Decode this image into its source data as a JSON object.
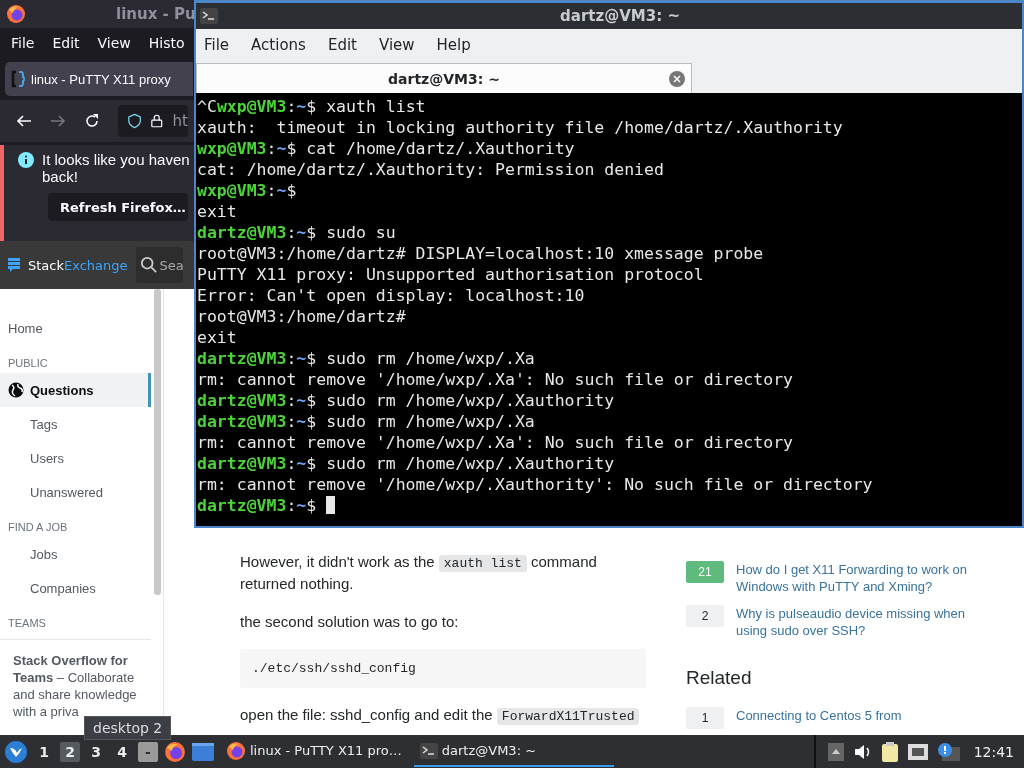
{
  "browser": {
    "title": "linux - Pu",
    "menu": [
      "File",
      "Edit",
      "View",
      "Histo"
    ],
    "tabs": [
      {
        "label": "linux - PuTTY X11 proxy",
        "selected": true
      }
    ],
    "address": "ht",
    "notification": {
      "lines": [
        "It looks like you haven",
        "back!"
      ],
      "button": "Refresh Firefox…"
    },
    "site_header": {
      "logo": [
        "Stack",
        "Exchange"
      ],
      "search_placeholder": "Sea"
    },
    "sidebar": [
      {
        "kind": "top",
        "label": "Home",
        "selected": false
      },
      {
        "kind": "heading",
        "label": "PUBLIC"
      },
      {
        "kind": "primary",
        "label": "Questions",
        "selected": true
      },
      {
        "kind": "sub",
        "label": "Tags",
        "selected": false
      },
      {
        "kind": "sub",
        "label": "Users",
        "selected": false
      },
      {
        "kind": "sub",
        "label": "Unanswered",
        "selected": false
      },
      {
        "kind": "heading",
        "label": "FIND A JOB"
      },
      {
        "kind": "sub",
        "label": "Jobs",
        "selected": false
      },
      {
        "kind": "sub",
        "label": "Companies",
        "selected": false
      },
      {
        "kind": "heading",
        "label": "TEAMS"
      }
    ],
    "teams_promo": "**Stack Overflow for Teams** – Collaborate and share knowledge with a priva",
    "post": [
      {
        "kind": "paragraph",
        "parts": [
          {
            "text": "However, it didn't work as the ",
            "code": false
          },
          {
            "text": "xauth list",
            "code": true
          },
          {
            "text": " command returned nothing.",
            "code": false
          }
        ]
      },
      {
        "kind": "paragraph",
        "parts": [
          {
            "text": "the second solution was to go to:",
            "code": false
          }
        ]
      },
      {
        "kind": "codeblock",
        "text": "./etc/ssh/sshd_config"
      },
      {
        "kind": "paragraph",
        "parts": [
          {
            "text": "open the file: sshd_config and edit the ",
            "code": false
          },
          {
            "text": "ForwardX11Trusted",
            "code": true
          }
        ]
      }
    ],
    "linked": [
      {
        "count": "21",
        "answered": true,
        "title": "How do I get X11 Forwarding to work on Windows with PuTTY and Xming?"
      },
      {
        "count": "2",
        "answered": false,
        "title": "Why is pulseaudio device missing when using sudo over SSH?"
      }
    ],
    "related_heading": "Related",
    "related": [
      {
        "count": "1",
        "answered": false,
        "title": "Connecting to Centos 5 from"
      }
    ]
  },
  "terminal": {
    "title": "dartz@VM3: ~",
    "menu": [
      "File",
      "Actions",
      "Edit",
      "View",
      "Help"
    ],
    "tabs": [
      {
        "label": "dartz@VM3: ~",
        "selected": true
      }
    ],
    "lines": [
      {
        "kind": "prompt",
        "pre": "^C",
        "user": "wxp@VM3",
        "sep": ":",
        "cwd": "~",
        "cmd": "$ xauth list",
        "cursor": false
      },
      {
        "kind": "output",
        "text": "xauth:  timeout in locking authority file /home/dartz/.Xauthority"
      },
      {
        "kind": "prompt",
        "user": "wxp@VM3",
        "sep": ":",
        "cwd": "~",
        "cmd": "$ cat /home/dartz/.Xauthority",
        "cursor": false
      },
      {
        "kind": "output",
        "text": "cat: /home/dartz/.Xauthority: Permission denied"
      },
      {
        "kind": "prompt",
        "user": "wxp@VM3",
        "sep": ":",
        "cwd": "~",
        "cmd": "$",
        "cursor": false
      },
      {
        "kind": "output",
        "text": "exit"
      },
      {
        "kind": "prompt",
        "user": "dartz@VM3",
        "sep": ":",
        "cwd": "~",
        "cmd": "$ sudo su",
        "cursor": false
      },
      {
        "kind": "output",
        "text": "root@VM3:/home/dartz# DISPLAY=localhost:10 xmessage probe"
      },
      {
        "kind": "output",
        "text": "PuTTY X11 proxy: Unsupported authorisation protocol"
      },
      {
        "kind": "output",
        "text": "Error: Can't open display: localhost:10"
      },
      {
        "kind": "output",
        "text": "root@VM3:/home/dartz#"
      },
      {
        "kind": "output",
        "text": "exit"
      },
      {
        "kind": "prompt",
        "user": "dartz@VM3",
        "sep": ":",
        "cwd": "~",
        "cmd": "$ sudo rm /home/wxp/.Xa",
        "cursor": false
      },
      {
        "kind": "output",
        "text": "rm: cannot remove '/home/wxp/.Xa': No such file or directory"
      },
      {
        "kind": "prompt",
        "user": "dartz@VM3",
        "sep": ":",
        "cwd": "~",
        "cmd": "$ sudo rm /home/wxp/.Xauthority",
        "cursor": false
      },
      {
        "kind": "prompt",
        "user": "dartz@VM3",
        "sep": ":",
        "cwd": "~",
        "cmd": "$ sudo rm /home/wxp/.Xa",
        "cursor": false
      },
      {
        "kind": "output",
        "text": "rm: cannot remove '/home/wxp/.Xa': No such file or directory"
      },
      {
        "kind": "prompt",
        "user": "dartz@VM3",
        "sep": ":",
        "cwd": "~",
        "cmd": "$ sudo rm /home/wxp/.Xauthority",
        "cursor": false
      },
      {
        "kind": "output",
        "text": "rm: cannot remove '/home/wxp/.Xauthority': No such file or directory"
      },
      {
        "kind": "prompt",
        "user": "dartz@VM3",
        "sep": ":",
        "cwd": "~",
        "cmd": "$ ",
        "cursor": true
      }
    ]
  },
  "taskbar": {
    "workspaces": [
      {
        "label": "1",
        "selected": false
      },
      {
        "label": "2",
        "selected": true
      },
      {
        "label": "3",
        "selected": false
      },
      {
        "label": "4",
        "selected": false
      }
    ],
    "show_desktop": "-",
    "tasks": [
      {
        "kind": "browser",
        "label": "linux - PuTTY X11 pro…",
        "active": false
      },
      {
        "kind": "terminal",
        "label": "dartz@VM3: ~",
        "active": true
      }
    ],
    "clock": "12:41",
    "tooltip": "desktop 2"
  }
}
